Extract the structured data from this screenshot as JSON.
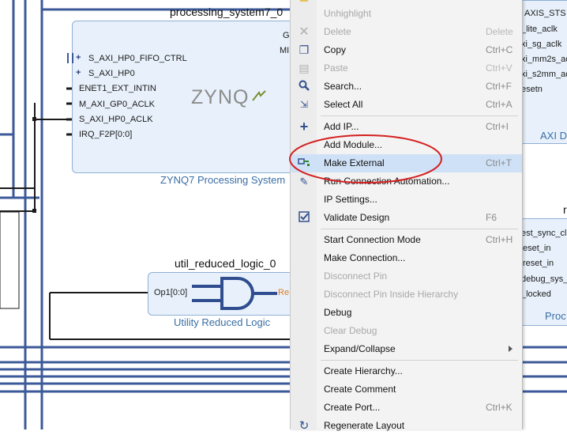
{
  "canvas": {
    "processing_system": {
      "instance": "processing_system7_0",
      "subtitle": "ZYNQ7 Processing System",
      "logo": "ZYNQ",
      "clipped_pins": [
        "G",
        "MI"
      ],
      "pins": [
        "S_AXI_HP0_FIFO_CTRL",
        "S_AXI_HP0",
        "ENET1_EXT_INTIN",
        "M_AXI_GP0_ACLK",
        "S_AXI_HP0_ACLK",
        "IRQ_F2P[0:0]"
      ]
    },
    "util_reduced_logic": {
      "instance": "util_reduced_logic_0",
      "subtitle": "Utility Reduced Logic",
      "in_pin": "Op1[0:0]",
      "out_pin_clipped": "Re"
    },
    "right_top_block": {
      "pins": [
        "AXIS_STS",
        "_lite_aclk",
        "xi_sg_aclk",
        "xi_mm2s_ac",
        "xi_s2mm_ac",
        "esetn"
      ],
      "subtitle_clipped": "AXI Di"
    },
    "right_bottom_block": {
      "header_clipped": "r",
      "pins": [
        "est_sync_clk",
        "eset_in",
        "reset_in",
        "debug_sys_r",
        "_locked"
      ],
      "subtitle_clipped": "Proc"
    }
  },
  "context_menu": {
    "items": [
      {
        "label": "Unhighlight",
        "shortcut": "",
        "disabled": true,
        "icon": ""
      },
      {
        "label": "Delete",
        "shortcut": "Delete",
        "disabled": true,
        "icon": "delete-x-icon"
      },
      {
        "label": "Copy",
        "shortcut": "Ctrl+C",
        "disabled": false,
        "icon": "copy-icon"
      },
      {
        "label": "Paste",
        "shortcut": "Ctrl+V",
        "disabled": true,
        "icon": "paste-icon"
      },
      {
        "label": "Search...",
        "shortcut": "Ctrl+F",
        "disabled": false,
        "icon": "search-icon"
      },
      {
        "label": "Select All",
        "shortcut": "Ctrl+A",
        "disabled": false,
        "icon": "select-all-icon"
      },
      {
        "label": "Add IP...",
        "shortcut": "Ctrl+I",
        "disabled": false,
        "icon": "plus-icon"
      },
      {
        "label": "Add Module...",
        "shortcut": "",
        "disabled": false,
        "icon": ""
      },
      {
        "label": "Make External",
        "shortcut": "Ctrl+T",
        "disabled": false,
        "icon": "make-external-icon",
        "highlighted": true
      },
      {
        "label": "Run Connection Automation...",
        "shortcut": "",
        "disabled": false,
        "icon": "pin-icon"
      },
      {
        "label": "IP Settings...",
        "shortcut": "",
        "disabled": false,
        "icon": ""
      },
      {
        "label": "Validate Design",
        "shortcut": "F6",
        "disabled": false,
        "icon": "validate-check-icon"
      },
      {
        "label": "Start Connection Mode",
        "shortcut": "Ctrl+H",
        "disabled": false,
        "icon": ""
      },
      {
        "label": "Make Connection...",
        "shortcut": "",
        "disabled": false,
        "icon": ""
      },
      {
        "label": "Disconnect Pin",
        "shortcut": "",
        "disabled": true,
        "icon": ""
      },
      {
        "label": "Disconnect Pin Inside Hierarchy",
        "shortcut": "",
        "disabled": true,
        "icon": ""
      },
      {
        "label": "Debug",
        "shortcut": "",
        "disabled": false,
        "icon": ""
      },
      {
        "label": "Clear Debug",
        "shortcut": "",
        "disabled": true,
        "icon": ""
      },
      {
        "label": "Expand/Collapse",
        "shortcut": "",
        "disabled": false,
        "icon": "",
        "submenu": true
      },
      {
        "label": "Create Hierarchy...",
        "shortcut": "",
        "disabled": false,
        "icon": ""
      },
      {
        "label": "Create Comment",
        "shortcut": "",
        "disabled": false,
        "icon": ""
      },
      {
        "label": "Create Port...",
        "shortcut": "Ctrl+K",
        "disabled": false,
        "icon": ""
      },
      {
        "label": "Regenerate Layout",
        "shortcut": "",
        "disabled": false,
        "icon": "regenerate-icon"
      }
    ]
  },
  "colors": {
    "wire": "#3c5a99",
    "block_fill": "#e8f1fb",
    "annotation_ellipse": "#d42020",
    "menu_highlight": "#cfe1f7"
  }
}
